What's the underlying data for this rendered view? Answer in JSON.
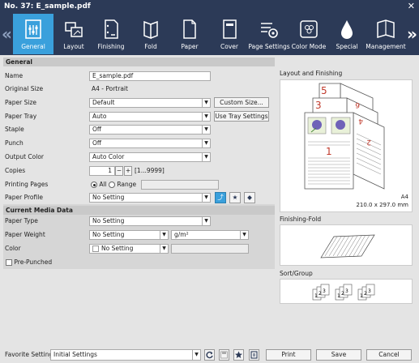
{
  "title": "No. 37: E_sample.pdf",
  "tabs": [
    {
      "label": "General",
      "icon": "general-icon",
      "active": true
    },
    {
      "label": "Layout",
      "icon": "layout-icon",
      "active": false
    },
    {
      "label": "Finishing",
      "icon": "finishing-icon",
      "active": false
    },
    {
      "label": "Fold",
      "icon": "fold-icon",
      "active": false
    },
    {
      "label": "Paper",
      "icon": "paper-icon",
      "active": false
    },
    {
      "label": "Cover",
      "icon": "cover-icon",
      "active": false
    },
    {
      "label": "Page Settings",
      "icon": "page-settings-icon",
      "active": false
    },
    {
      "label": "Color Mode",
      "icon": "color-mode-icon",
      "active": false
    },
    {
      "label": "Special",
      "icon": "special-icon",
      "active": false
    },
    {
      "label": "Management",
      "icon": "management-icon",
      "active": false
    }
  ],
  "general": {
    "section_title": "General",
    "name_label": "Name",
    "name_value": "E_sample.pdf",
    "original_size_label": "Original Size",
    "original_size_value": "A4 - Portrait",
    "paper_size_label": "Paper Size",
    "paper_size_value": "Default",
    "custom_size_button": "Custom Size...",
    "paper_tray_label": "Paper Tray",
    "paper_tray_value": "Auto",
    "use_tray_button": "Use Tray Settings",
    "staple_label": "Staple",
    "staple_value": "Off",
    "punch_label": "Punch",
    "punch_value": "Off",
    "output_color_label": "Output Color",
    "output_color_value": "Auto Color",
    "copies_label": "Copies",
    "copies_value": "1",
    "copies_range": "[1...9999]",
    "copies_minus": "−",
    "copies_plus": "+",
    "printing_pages_label": "Printing Pages",
    "radio_all": "All",
    "radio_range": "Range",
    "paper_profile_label": "Paper Profile",
    "paper_profile_value": "No Setting"
  },
  "current_media": {
    "section_title": "Current Media Data",
    "paper_type_label": "Paper Type",
    "paper_type_value": "No Setting",
    "paper_weight_label": "Paper Weight",
    "paper_weight_value": "No Setting",
    "paper_weight_unit": "g/m²",
    "color_label": "Color",
    "color_value": "No Setting",
    "pre_punched_label": "Pre-Punched"
  },
  "preview": {
    "layout_label": "Layout and Finishing",
    "page_numbers": [
      "1",
      "3",
      "5"
    ],
    "page_numbers_rotated": [
      "2",
      "4",
      "6"
    ],
    "paper_name": "A4",
    "paper_dims": "210.0 x 297.0 mm",
    "fold_label": "Finishing-Fold",
    "sort_label": "Sort/Group",
    "sort_digits": [
      "1",
      "2",
      "3"
    ]
  },
  "bottom": {
    "favorite_label": "Favorite Setting",
    "favorite_value": "Initial Settings",
    "print_button": "Print",
    "save_button": "Save",
    "cancel_button": "Cancel"
  },
  "colors": {
    "titlebar": "#2c3a57",
    "active_tab": "#3aa0dc",
    "page_number": "#c0392b"
  }
}
